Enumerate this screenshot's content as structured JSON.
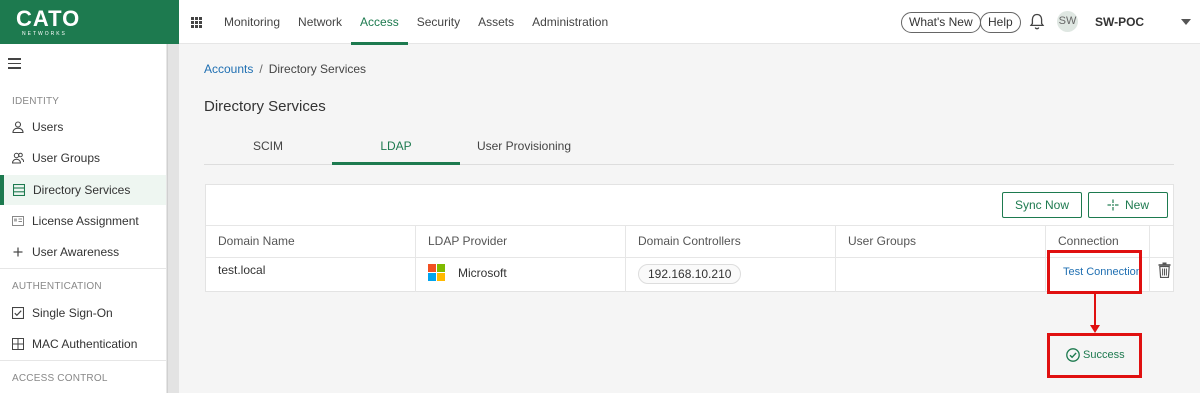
{
  "brand": {
    "name": "CATO",
    "tagline": "NETWORKS",
    "color": "#1d7a4f"
  },
  "topnav": {
    "items": [
      {
        "label": "Monitoring",
        "active": false
      },
      {
        "label": "Network",
        "active": false
      },
      {
        "label": "Access",
        "active": true
      },
      {
        "label": "Security",
        "active": false
      },
      {
        "label": "Assets",
        "active": false
      },
      {
        "label": "Administration",
        "active": false
      }
    ],
    "whats_new": "What's New",
    "help": "Help",
    "avatar_initials": "SW",
    "account": "SW-POC"
  },
  "sidebar": {
    "sections": [
      {
        "title": "IDENTITY",
        "items": [
          {
            "label": "Users",
            "icon": "user-icon"
          },
          {
            "label": "User Groups",
            "icon": "user-group-icon"
          },
          {
            "label": "Directory Services",
            "icon": "directory-icon",
            "active": true
          },
          {
            "label": "License Assignment",
            "icon": "license-icon"
          },
          {
            "label": "User Awareness",
            "icon": "plus-icon"
          }
        ]
      },
      {
        "title": "AUTHENTICATION",
        "items": [
          {
            "label": "Single Sign-On",
            "icon": "checkbox-icon"
          },
          {
            "label": "MAC Authentication",
            "icon": "grid-icon"
          }
        ]
      },
      {
        "title": "ACCESS CONTROL",
        "items": []
      }
    ]
  },
  "breadcrumb": {
    "parent": "Accounts",
    "separator": "/",
    "current": "Directory Services"
  },
  "page_title": "Directory Services",
  "tabs": [
    {
      "label": "SCIM",
      "active": false
    },
    {
      "label": "LDAP",
      "active": true
    },
    {
      "label": "User Provisioning",
      "active": false
    }
  ],
  "toolbar": {
    "sync_now": "Sync Now",
    "new": "New"
  },
  "table": {
    "columns": [
      "Domain Name",
      "LDAP Provider",
      "Domain Controllers",
      "User Groups",
      "Connection"
    ],
    "rows": [
      {
        "domain_name": "test.local",
        "ldap_provider": "Microsoft",
        "domain_controllers": "192.168.10.210",
        "user_groups": "",
        "connection": "Test Connection"
      }
    ]
  },
  "result": {
    "status": "Success",
    "color": "#1d7a4f"
  },
  "annotation_color": "#e01010"
}
